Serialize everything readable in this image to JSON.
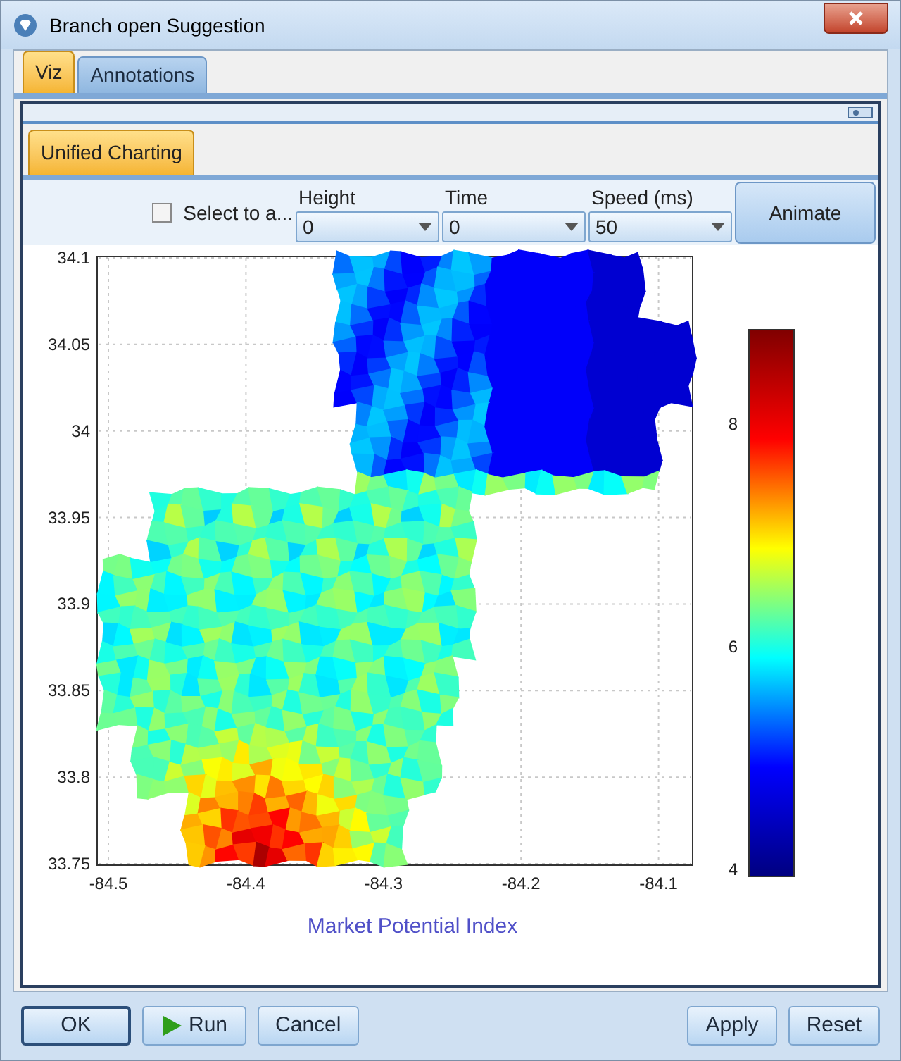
{
  "window": {
    "title": "Branch open Suggestion"
  },
  "tabs": [
    {
      "label": "Viz",
      "selected": true
    },
    {
      "label": "Annotations",
      "selected": false
    }
  ],
  "subtabs": [
    {
      "label": "Unified Charting",
      "selected": true
    }
  ],
  "controls": {
    "checkbox": {
      "label": "Select to a...",
      "checked": false
    },
    "dropdowns": [
      {
        "label": "Height",
        "value": "0"
      },
      {
        "label": "Time",
        "value": "0"
      },
      {
        "label": "Speed (ms)",
        "value": "50"
      }
    ],
    "animate_button": "Animate"
  },
  "map": {
    "yticks": [
      "34.1",
      "34.05",
      "34",
      "33.95",
      "33.9",
      "33.85",
      "33.8",
      "33.75"
    ],
    "xticks": [
      "-84.5",
      "-84.4",
      "-84.3",
      "-84.2",
      "-84.1"
    ],
    "colorbar_ticks": [
      "8",
      "6",
      "4"
    ],
    "title": "Market Potential Index"
  },
  "buttons_left": [
    {
      "label": "OK",
      "kind": "default"
    },
    {
      "label": "Run",
      "kind": "run"
    },
    {
      "label": "Cancel",
      "kind": "plain"
    }
  ],
  "buttons_right": [
    {
      "label": "Apply"
    },
    {
      "label": "Reset"
    }
  ]
}
